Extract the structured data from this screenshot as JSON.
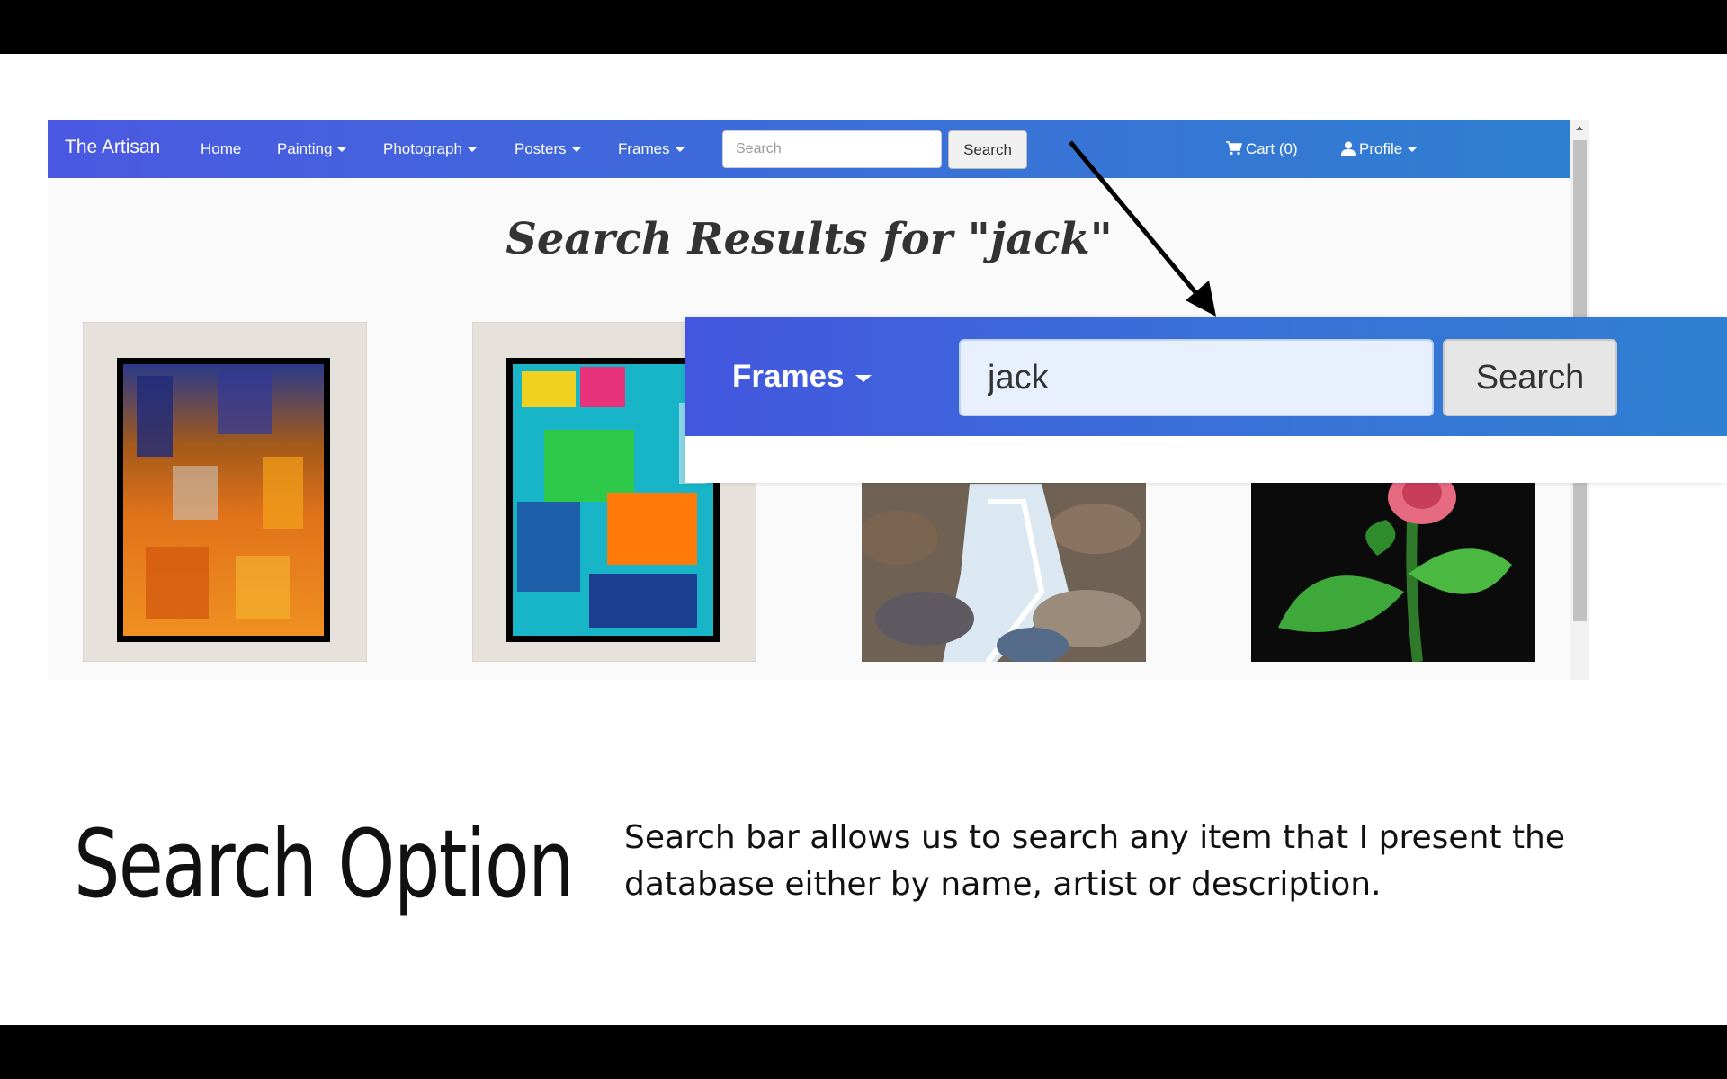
{
  "navbar": {
    "brand": "The Artisan",
    "items": [
      {
        "label": "Home",
        "dropdown": false
      },
      {
        "label": "Painting",
        "dropdown": true
      },
      {
        "label": "Photograph",
        "dropdown": true
      },
      {
        "label": "Posters",
        "dropdown": true
      },
      {
        "label": "Frames",
        "dropdown": true
      }
    ],
    "search_placeholder": "Search",
    "search_button": "Search",
    "cart_label": "Cart (0)",
    "profile_label": "Profile",
    "gradient_colors": [
      "#4b58e2",
      "#2f7fd1"
    ]
  },
  "results": {
    "title": "Search Results for \"jack\"",
    "items": [
      {
        "kind": "framed-abstract-warm"
      },
      {
        "kind": "framed-abstract-cool"
      },
      {
        "kind": "waterfall-painting"
      },
      {
        "kind": "rose-painting"
      }
    ]
  },
  "zoom": {
    "frames_label": "Frames",
    "search_value": "jack",
    "search_button": "Search"
  },
  "caption": {
    "title": "Search Option",
    "description": "Search bar allows us to search any item that I present the database either by name, artist or description."
  },
  "icons": [
    "cart-icon",
    "user-icon",
    "caret-down-icon",
    "arrow-icon"
  ]
}
